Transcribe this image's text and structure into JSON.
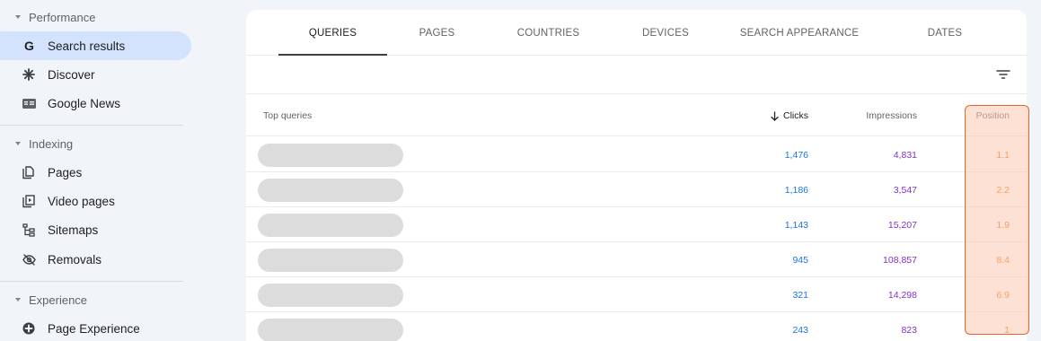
{
  "sidebar": {
    "sections": [
      {
        "title": "Performance",
        "items": [
          {
            "label": "Search results",
            "icon": "google-g-icon",
            "active": true
          },
          {
            "label": "Discover",
            "icon": "asterisk-icon",
            "active": false
          },
          {
            "label": "Google News",
            "icon": "news-icon",
            "active": false
          }
        ]
      },
      {
        "title": "Indexing",
        "items": [
          {
            "label": "Pages",
            "icon": "pages-icon"
          },
          {
            "label": "Video pages",
            "icon": "video-pages-icon"
          },
          {
            "label": "Sitemaps",
            "icon": "sitemaps-icon"
          },
          {
            "label": "Removals",
            "icon": "eye-off-icon"
          }
        ]
      },
      {
        "title": "Experience",
        "items": [
          {
            "label": "Page Experience",
            "icon": "page-experience-icon"
          }
        ]
      }
    ]
  },
  "tabs": [
    "QUERIES",
    "PAGES",
    "COUNTRIES",
    "DEVICES",
    "SEARCH APPEARANCE",
    "DATES"
  ],
  "active_tab": "QUERIES",
  "table": {
    "headers": {
      "query": "Top queries",
      "clicks": "Clicks",
      "impressions": "Impressions",
      "position": "Position"
    },
    "rows": [
      {
        "clicks": "1,476",
        "impressions": "4,831",
        "position": "1.1"
      },
      {
        "clicks": "1,186",
        "impressions": "3,547",
        "position": "2.2"
      },
      {
        "clicks": "1,143",
        "impressions": "15,207",
        "position": "1.9"
      },
      {
        "clicks": "945",
        "impressions": "108,857",
        "position": "8.4"
      },
      {
        "clicks": "321",
        "impressions": "14,298",
        "position": "6.9"
      },
      {
        "clicks": "243",
        "impressions": "823",
        "position": "1"
      }
    ]
  },
  "colors": {
    "clicks": "#1a73e8",
    "impressions": "#8430ce",
    "position": "#e8710a",
    "active_nav": "#d3e3fd",
    "highlight_border": "#e8642a"
  }
}
